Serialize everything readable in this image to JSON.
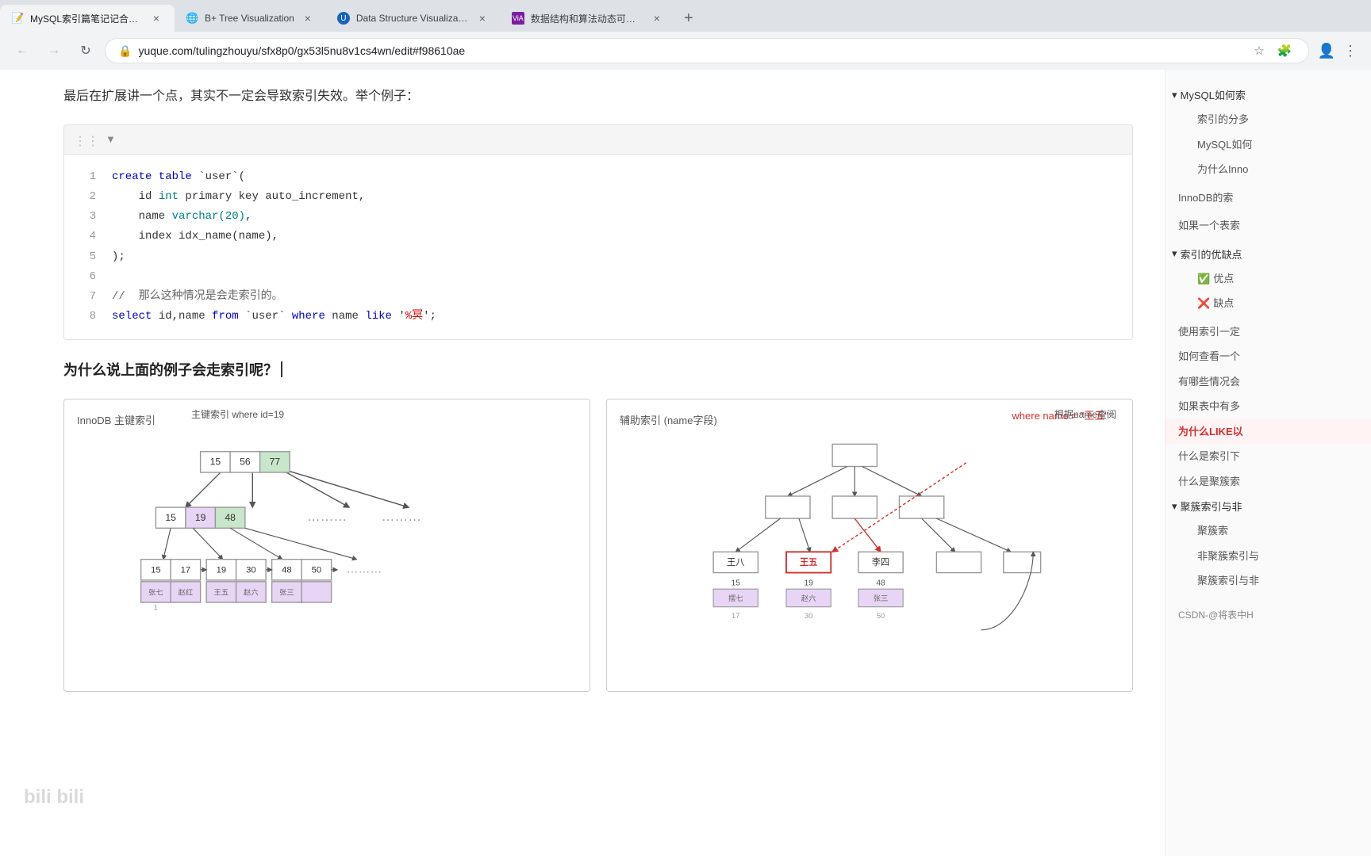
{
  "browser": {
    "tabs": [
      {
        "id": "tab1",
        "title": "MySQL索引篇笔记记合集 · 语雀",
        "favicon": "📝",
        "active": true
      },
      {
        "id": "tab2",
        "title": "B+ Tree Visualization",
        "favicon": "🌐",
        "active": false
      },
      {
        "id": "tab3",
        "title": "Data Structure Visualization",
        "favicon": "🔵",
        "active": false
      },
      {
        "id": "tab4",
        "title": "数据结构和算法动态可视化 (Chi…",
        "favicon": "🔴",
        "active": false
      }
    ],
    "url": "yuque.com/tulingzhouyu/sfx8p0/gx53l5nu8v1cs4wn/edit#f98610ae"
  },
  "content": {
    "intro_text": "最后在扩展讲一个点，其实不一定会导致索引失效。举个例子：",
    "code_lines": [
      {
        "num": "1",
        "tokens": [
          {
            "text": "create table",
            "cls": "kw-blue"
          },
          {
            "text": " `user`(",
            "cls": ""
          }
        ]
      },
      {
        "num": "2",
        "tokens": [
          {
            "text": "    id ",
            "cls": ""
          },
          {
            "text": "int",
            "cls": "kw-teal"
          },
          {
            "text": " primary key auto_increment,",
            "cls": ""
          }
        ]
      },
      {
        "num": "3",
        "tokens": [
          {
            "text": "    name ",
            "cls": ""
          },
          {
            "text": "varchar(20)",
            "cls": "kw-teal"
          },
          {
            "text": ",",
            "cls": ""
          }
        ]
      },
      {
        "num": "4",
        "tokens": [
          {
            "text": "    index idx_name(name),",
            "cls": ""
          }
        ]
      },
      {
        "num": "5",
        "tokens": [
          {
            "text": ");",
            "cls": ""
          }
        ]
      },
      {
        "num": "6",
        "tokens": [
          {
            "text": "",
            "cls": ""
          }
        ]
      },
      {
        "num": "7",
        "tokens": [
          {
            "text": "// ",
            "cls": "kw-comment"
          },
          {
            "text": "那么这种情况是会走索引的。",
            "cls": "kw-comment"
          }
        ]
      },
      {
        "num": "8",
        "tokens": [
          {
            "text": "select",
            "cls": "kw-blue"
          },
          {
            "text": " id,name ",
            "cls": ""
          },
          {
            "text": "from",
            "cls": "kw-blue"
          },
          {
            "text": " `user` ",
            "cls": ""
          },
          {
            "text": "where",
            "cls": "kw-blue"
          },
          {
            "text": " name ",
            "cls": ""
          },
          {
            "text": "like",
            "cls": "kw-blue"
          },
          {
            "text": " '",
            "cls": ""
          },
          {
            "text": "%冥",
            "cls": "kw-red"
          },
          {
            "text": "';",
            "cls": ""
          }
        ]
      }
    ],
    "question_text": "为什么说上面的例子会走索引呢？",
    "diagram": {
      "left_panel": {
        "title": "InnoDB 主键索引",
        "annotation_key": "主键索引 where id=19",
        "root_node": [
          15,
          56,
          77
        ],
        "level2": [
          [
            15,
            19,
            48
          ],
          "………",
          "………"
        ],
        "level3": [
          [
            15,
            17
          ],
          [
            19,
            30
          ],
          [
            48,
            50
          ],
          "………"
        ]
      },
      "right_panel": {
        "title": "辅助索引 (name字段)",
        "where_annotation": "where name = \"王五\"",
        "lookup_annotation": "根据name查阅"
      }
    }
  },
  "sidebar": {
    "items": [
      {
        "id": "s1",
        "text": "MySQL如何索",
        "level": 0,
        "expanded": true,
        "type": "parent"
      },
      {
        "id": "s2",
        "text": "索引的分多",
        "level": 1,
        "type": "item"
      },
      {
        "id": "s3",
        "text": "MySQL如何",
        "level": 1,
        "type": "item"
      },
      {
        "id": "s4",
        "text": "为什么Inno",
        "level": 1,
        "type": "item"
      },
      {
        "id": "s5",
        "text": "InnoDB的索",
        "level": 0,
        "type": "item"
      },
      {
        "id": "s6",
        "text": "如果一个表索",
        "level": 0,
        "type": "item"
      },
      {
        "id": "s7",
        "text": "索引的优缺点",
        "level": 0,
        "expanded": true,
        "type": "parent"
      },
      {
        "id": "s8",
        "text": "✅ 优点",
        "level": 1,
        "type": "item",
        "has_check": true
      },
      {
        "id": "s9",
        "text": "❌ 缺点",
        "level": 1,
        "type": "item",
        "has_x": true
      },
      {
        "id": "s10",
        "text": "使用索引一定",
        "level": 0,
        "type": "item"
      },
      {
        "id": "s11",
        "text": "如何查看一个",
        "level": 0,
        "type": "item"
      },
      {
        "id": "s12",
        "text": "有哪些情况会",
        "level": 0,
        "type": "item"
      },
      {
        "id": "s13",
        "text": "如果表中有多",
        "level": 0,
        "type": "item"
      },
      {
        "id": "s14",
        "text": "为什么LIKE以",
        "level": 0,
        "type": "item",
        "highlighted": true
      },
      {
        "id": "s15",
        "text": "什么是索引下",
        "level": 0,
        "type": "item"
      },
      {
        "id": "s16",
        "text": "什么是聚簇索",
        "level": 0,
        "type": "item"
      },
      {
        "id": "s17",
        "text": "聚簇索引与非",
        "level": 0,
        "expanded": true,
        "type": "parent"
      },
      {
        "id": "s18",
        "text": "聚簇索",
        "level": 1,
        "type": "item"
      },
      {
        "id": "s19",
        "text": "非聚簇索引与",
        "level": 1,
        "type": "item"
      },
      {
        "id": "s20",
        "text": "聚簇索引与非",
        "level": 1,
        "type": "item"
      },
      {
        "id": "s21",
        "text": "CSDN-@将表中H",
        "level": 0,
        "type": "item",
        "bottom": true
      }
    ]
  },
  "icons": {
    "back": "←",
    "forward": "→",
    "refresh": "↻",
    "home": "⌂",
    "lock": "🔒",
    "star": "☆",
    "extension": "🧩",
    "menu": "⋮",
    "tab_close": "×",
    "tab_new": "+",
    "dropdown": "▼",
    "drag": "⋮⋮",
    "chevron_down": "▾",
    "chevron_right": "▸"
  }
}
